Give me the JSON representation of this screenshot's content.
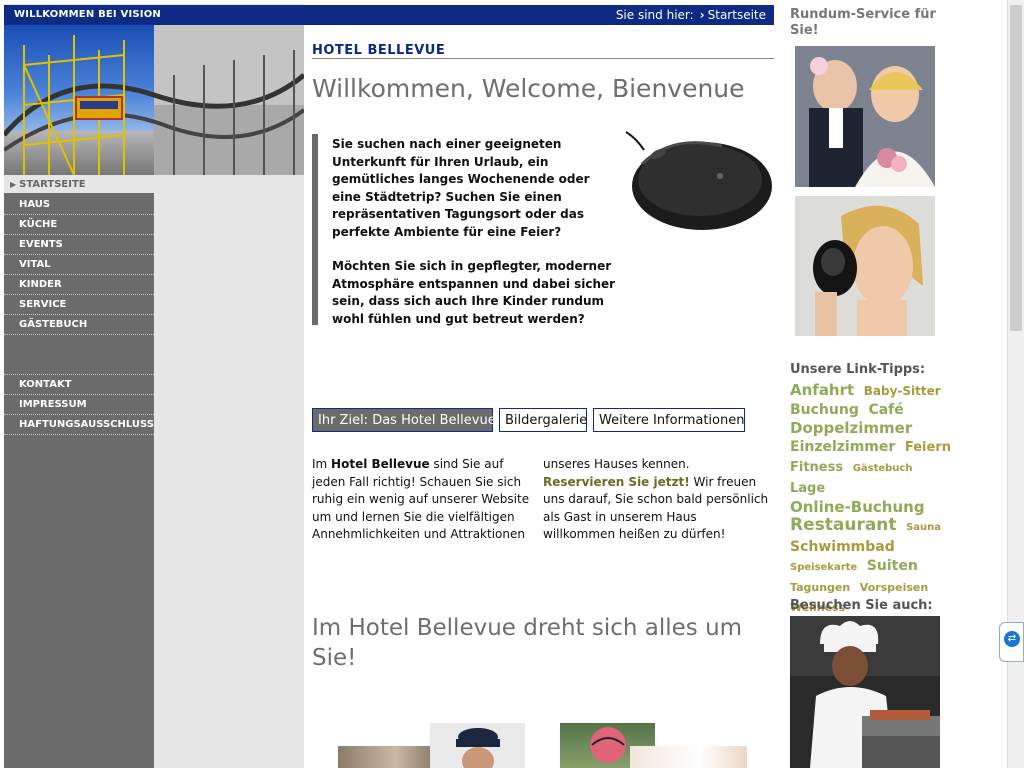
{
  "topbar": {
    "brand": "WILLKOMMEN BEI VISION",
    "crumb_label": "Sie sind hier:",
    "crumb_current": "Startseite"
  },
  "nav": {
    "start": "STARTSEITE",
    "items_top": [
      "HAUS",
      "KÜCHE",
      "EVENTS",
      "VITAL",
      "KINDER",
      "SERVICE",
      "GÄSTEBUCH"
    ],
    "items_bottom": [
      "KONTAKT",
      "IMPRESSUM",
      "HAFTUNGSAUSSCHLUSS"
    ]
  },
  "main": {
    "hotel_name": "HOTEL BELLEVUE",
    "welcome": "Willkommen, Welcome, Bienvenue",
    "intro_p1": "Sie suchen nach einer geeigneten Unterkunft für Ihren Urlaub, ein gemütliches langes Wochenende oder eine Städtetrip? Suchen Sie einen repräsentativen Tagungsort oder das perfekte Ambiente für eine Feier?",
    "intro_p2": "Möchten Sie sich in gepflegter, moderner Atmosphäre entspannen und dabei sicher sein, dass sich auch Ihre Kinder rundum wohl fühlen und gut betreut werden?",
    "buttons": [
      "Ihr Ziel: Das Hotel Bellevue",
      "Bildergalerie",
      "Weitere Informationen"
    ],
    "col1_pre": "Im ",
    "col1_bold": "Hotel Bellevue",
    "col1_post": " sind Sie auf jeden Fall richtig! Schauen Sie sich ruhig ein wenig auf unserer Website um und lernen Sie die vielfältigen Annehmlichkeiten und Attraktionen",
    "col2_pre": "unseres Hauses kennen.",
    "col2_link": "Reservieren Sie jetzt!",
    "col2_post": " Wir freuen uns darauf, Sie schon bald persönlich als Gast in unserem Haus willkommen heißen zu dürfen!",
    "slogan": "Im Hotel Bellevue dreht sich alles um Sie!"
  },
  "right": {
    "service_title": "Rundum-Service für Sie!",
    "linktips_title": "Unsere Link-Tipps:",
    "tags": [
      {
        "text": "Anfahrt",
        "size": 15,
        "kind": "l"
      },
      {
        "text": "Baby-Sitter",
        "size": 12,
        "kind": "d"
      },
      {
        "text": "Buchung",
        "size": 14,
        "kind": "l"
      },
      {
        "text": "Café",
        "size": 14,
        "kind": "l"
      },
      {
        "text": "Doppelzimmer",
        "size": 15,
        "kind": "l"
      },
      {
        "text": "Einzelzimmer",
        "size": 14,
        "kind": "l"
      },
      {
        "text": "Feiern",
        "size": 13,
        "kind": "d"
      },
      {
        "text": "Fitness",
        "size": 13,
        "kind": "l"
      },
      {
        "text": "Gästebuch",
        "size": 10,
        "kind": "d"
      },
      {
        "text": "Lage",
        "size": 13,
        "kind": "l"
      },
      {
        "text": "Online-Buchung",
        "size": 15,
        "kind": "l"
      },
      {
        "text": "Restaurant",
        "size": 17,
        "kind": "l"
      },
      {
        "text": "Sauna",
        "size": 10,
        "kind": "d"
      },
      {
        "text": "Schwimmbad",
        "size": 14,
        "kind": "d"
      },
      {
        "text": "Speisekarte",
        "size": 10,
        "kind": "d"
      },
      {
        "text": "Suiten",
        "size": 14,
        "kind": "l"
      },
      {
        "text": "Tagungen",
        "size": 11,
        "kind": "d"
      },
      {
        "text": "Vorspeisen",
        "size": 11,
        "kind": "d"
      },
      {
        "text": "Wellness",
        "size": 11,
        "kind": "d"
      }
    ],
    "visit_title": "Besuchen Sie auch:"
  },
  "colors": {
    "navy": "#0d2a84",
    "nav_gray": "#6b6b6b",
    "tag_light": "#8faa58",
    "tag_dark": "#a99a3f"
  }
}
